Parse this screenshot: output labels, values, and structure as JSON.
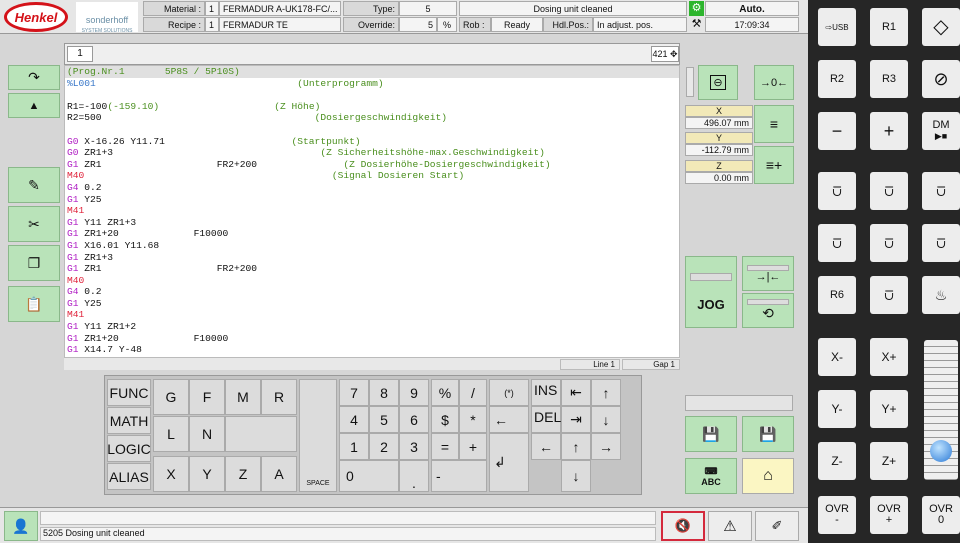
{
  "header": {
    "brand": "Henkel",
    "brand2": "sonderhoff",
    "brand2_sub": "SYSTEM SOLUTIONS",
    "material_label": "Material :",
    "material_num": "1",
    "material_val": "FERMADUR A-UK178-FC/...",
    "recipe_label": "Recipe :",
    "recipe_num": "1",
    "recipe_val": "FERMADUR TE",
    "type_label": "Type:",
    "type_val": "5",
    "override_label": "Override:",
    "override_val": "5",
    "override_unit": "%",
    "status_msg": "Dosing unit cleaned",
    "rob_label": "Rob :",
    "rob_val": "Ready",
    "hdl_label": "Hdl.Pos.:",
    "hdl_val": "In adjust. pos.",
    "mode": "Auto.",
    "time": "17:09:34"
  },
  "tabs": {
    "tab1": "1",
    "count": "421"
  },
  "editor": {
    "lines": [
      [
        {
          "t": "(Prog.Nr.1       5P8S / 5P10S)",
          "c": "g"
        }
      ],
      [
        {
          "t": "%L001",
          "c": "b"
        },
        {
          "t": "                                   (Unterprogramm)",
          "c": "g"
        }
      ],
      [
        {
          "t": "",
          "c": "k"
        }
      ],
      [
        {
          "t": "R1=-100",
          "c": "k"
        },
        {
          "t": "(-159.10)                    (Z Höhe)",
          "c": "g"
        }
      ],
      [
        {
          "t": "R2=500",
          "c": "k"
        },
        {
          "t": "                                     (Dosiergeschwindigkeit)",
          "c": "g"
        }
      ],
      [
        {
          "t": "",
          "c": "k"
        }
      ],
      [
        {
          "t": "G0",
          "c": "p"
        },
        {
          "t": " X-16.26 Y11.71",
          "c": "k"
        },
        {
          "t": "                      (Startpunkt)",
          "c": "g"
        }
      ],
      [
        {
          "t": "G0",
          "c": "p"
        },
        {
          "t": " ZR1+3",
          "c": "k"
        },
        {
          "t": "                                    (Z Sicherheitshöhe-max.Geschwindigkeit)",
          "c": "g"
        }
      ],
      [
        {
          "t": "G1",
          "c": "p"
        },
        {
          "t": " ZR1                    FR2+200",
          "c": "k"
        },
        {
          "t": "               (Z Dosierhöhe-Dosiergeschwindigkeit)",
          "c": "g"
        }
      ],
      [
        {
          "t": "M40",
          "c": "r"
        },
        {
          "t": "                                           (Signal Dosieren Start)",
          "c": "g"
        }
      ],
      [
        {
          "t": "G4",
          "c": "p"
        },
        {
          "t": " 0.2",
          "c": "k"
        }
      ],
      [
        {
          "t": "G1",
          "c": "p"
        },
        {
          "t": " Y25",
          "c": "k"
        }
      ],
      [
        {
          "t": "M41",
          "c": "r"
        }
      ],
      [
        {
          "t": "G1",
          "c": "p"
        },
        {
          "t": " Y11 ZR1+3",
          "c": "k"
        }
      ],
      [
        {
          "t": "G1",
          "c": "p"
        },
        {
          "t": " ZR1+20             F10000",
          "c": "k"
        }
      ],
      [
        {
          "t": "G1",
          "c": "p"
        },
        {
          "t": " X16.01 Y11.68",
          "c": "k"
        }
      ],
      [
        {
          "t": "G1",
          "c": "p"
        },
        {
          "t": " ZR1+3",
          "c": "k"
        }
      ],
      [
        {
          "t": "G1",
          "c": "p"
        },
        {
          "t": " ZR1                    FR2+200",
          "c": "k"
        }
      ],
      [
        {
          "t": "M40",
          "c": "r"
        }
      ],
      [
        {
          "t": "G4",
          "c": "p"
        },
        {
          "t": " 0.2",
          "c": "k"
        }
      ],
      [
        {
          "t": "G1",
          "c": "p"
        },
        {
          "t": " Y25",
          "c": "k"
        }
      ],
      [
        {
          "t": "M41",
          "c": "r"
        }
      ],
      [
        {
          "t": "G1",
          "c": "p"
        },
        {
          "t": " Y11 ZR1+2",
          "c": "k"
        }
      ],
      [
        {
          "t": "G1",
          "c": "p"
        },
        {
          "t": " ZR1+20             F10000",
          "c": "k"
        }
      ],
      [
        {
          "t": "G1",
          "c": "p"
        },
        {
          "t": " X14.7 Y-48",
          "c": "k"
        }
      ]
    ],
    "line_status": "Line 1",
    "gap_status": "Gap 1"
  },
  "axes": {
    "x_label": "X",
    "x_val": "496.07",
    "y_label": "Y",
    "y_val": "-112.79",
    "z_label": "Z",
    "z_val": "0.00",
    "unit": "mm"
  },
  "buttons": {
    "jog": "JOG",
    "abc": "ABC"
  },
  "keyboard": {
    "fn": [
      "FUNC",
      "MATH",
      "LOGIC",
      "ALIAS"
    ],
    "letters": [
      "G",
      "F",
      "M",
      "R",
      "L",
      "N",
      "X",
      "Y",
      "Z",
      "A"
    ],
    "space": "SPACE",
    "digits": [
      "7",
      "8",
      "9",
      "4",
      "5",
      "6",
      "1",
      "2",
      "3",
      "0",
      "."
    ],
    "ops": [
      "%",
      "/",
      "$",
      "*",
      "=",
      "+",
      "-"
    ],
    "paren": "(*)",
    "ins": "INS",
    "del": "DEL"
  },
  "footer": {
    "message": "5205 Dosing unit cleaned"
  },
  "rpanel": {
    "usb": "USB",
    "r1": "R1",
    "r2": "R2",
    "r3": "R3",
    "minus": "−",
    "plus": "+",
    "dm": "DM",
    "r6": "R6",
    "xm": "X-",
    "xp": "X+",
    "ym": "Y-",
    "yp": "Y+",
    "zm": "Z-",
    "zp": "Z+",
    "ovrm": "OVR\n-",
    "ovrp": "OVR\n+",
    "ovr0": "OVR\n0",
    "slider_level": 0.15
  }
}
